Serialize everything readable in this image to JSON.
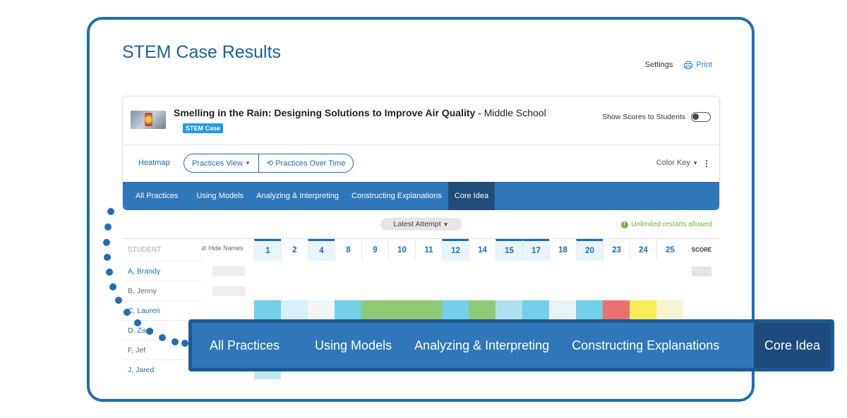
{
  "page": {
    "title": "STEM Case Results"
  },
  "top_actions": {
    "settings": "Settings",
    "print": "Print"
  },
  "case": {
    "title": "Smelling in the Rain: Designing Solutions to Improve Air Quality",
    "subtitle": " - Middle School",
    "tag": "STEM Case",
    "show_scores_label": "Show Scores to Students"
  },
  "toolbar": {
    "heatmap": "Heatmap",
    "practices_view": "Practices View",
    "practices_over_time": "Practices Over Time",
    "color_key": "Color Key"
  },
  "tabs": [
    "All Practices",
    "Using Models",
    "Analyzing & Interpreting",
    "Constructing Explanations",
    "Core Idea"
  ],
  "active_tab": "Core Idea",
  "attempt": "Latest Attempt",
  "restarts": "Unlimited restarts allowed",
  "grid": {
    "student_header": "STUDENT",
    "hide_names": "Hide Names",
    "columns": [
      "1",
      "2",
      "4",
      "8",
      "9",
      "10",
      "11",
      "12",
      "14",
      "15",
      "17",
      "18",
      "20",
      "23",
      "24",
      "25"
    ],
    "highlighted_columns": [
      "1",
      "4",
      "12",
      "15",
      "17",
      "20"
    ],
    "score_header": "SCORE",
    "students": [
      {
        "name": "A, Brandy",
        "link": true
      },
      {
        "name": "B, Jenny",
        "link": false
      },
      {
        "name": "C, Lauren",
        "link": true
      },
      {
        "name": "D, Zach",
        "link": true
      },
      {
        "name": "F, Jef",
        "link": false
      },
      {
        "name": "J, Jared",
        "link": true
      }
    ]
  },
  "colors": {
    "accent": "#1f6db3",
    "tab_bar": "#2f77b8",
    "tab_active": "#1f4c79",
    "cyan": "#5bc8e3",
    "green": "#7dbf5a",
    "red": "#e8575a",
    "yellow": "#f4ea3a"
  }
}
